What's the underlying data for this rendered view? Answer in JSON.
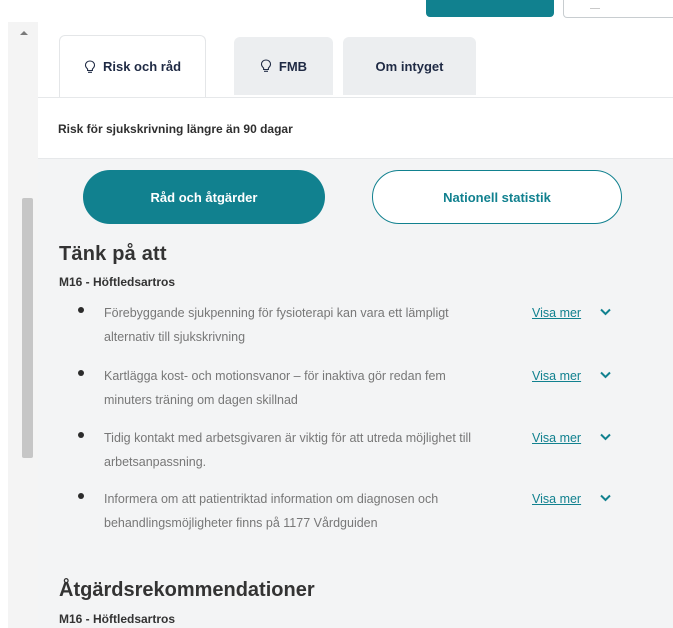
{
  "tabs": [
    {
      "label": "Risk och råd",
      "icon": "lightbulb-icon",
      "active": true
    },
    {
      "label": "FMB",
      "icon": "lightbulb-icon",
      "active": false
    },
    {
      "label": "Om intyget",
      "active": false
    }
  ],
  "risk_header": "Risk för sjukskrivning längre än 90 dagar",
  "buttons": {
    "rad": "Råd och åtgärder",
    "nationell": "Nationell statistik"
  },
  "tank_section": {
    "title": "Tänk på att",
    "diagnosis": "M16 - Höftledsartros",
    "items": [
      {
        "text": "Förebyggande sjukpenning för fysioterapi kan vara ett lämpligt alternativ till sjukskrivning",
        "link": "Visa mer"
      },
      {
        "text": "Kartlägga kost- och motionsvanor – för inaktiva gör redan fem minuters träning om dagen skillnad",
        "link": "Visa mer"
      },
      {
        "text": "Tidig kontakt med arbetsgivaren är viktig för att utreda möjlighet till arbetsanpassning.",
        "link": "Visa mer"
      },
      {
        "text": "Informera om att patientriktad information om diagnosen och behandlingsmöjligheter finns på 1177 Vårdguiden",
        "link": "Visa mer"
      }
    ]
  },
  "atgard_section": {
    "title": "Åtgärdsrekommendationer",
    "diagnosis": "M16 - Höftledsartros"
  },
  "colors": {
    "accent": "#11818f",
    "panel_bg": "#f3f4f5",
    "tab_bg": "#eceef0",
    "text_muted": "#777777"
  }
}
